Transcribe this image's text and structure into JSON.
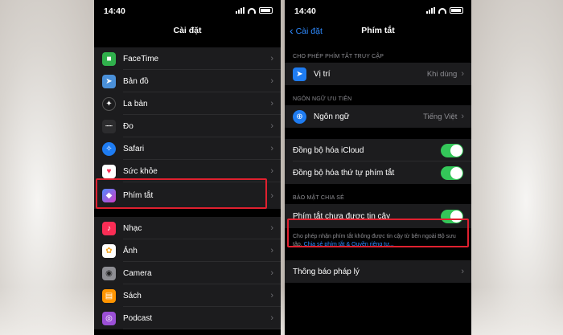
{
  "left": {
    "status_time": "14:40",
    "title": "Cài đặt",
    "group1": [
      {
        "label": "FaceTime",
        "icon": "facetime-icon",
        "color": "#30b04c"
      },
      {
        "label": "Bản đồ",
        "icon": "maps-icon",
        "color": "#4a90d9"
      },
      {
        "label": "La bàn",
        "icon": "compass-icon",
        "color": "#1c1c1e"
      },
      {
        "label": "Đo",
        "icon": "measure-icon",
        "color": "#1c1c1e"
      },
      {
        "label": "Safari",
        "icon": "safari-icon",
        "color": "#1e7cf2"
      },
      {
        "label": "Sức khỏe",
        "icon": "health-icon",
        "color": "#ffffff"
      },
      {
        "label": "Phím tắt",
        "icon": "shortcuts-icon",
        "color": "#5a4fd6"
      }
    ],
    "group2": [
      {
        "label": "Nhạc",
        "icon": "music-icon",
        "color": "#fa2d55"
      },
      {
        "label": "Ảnh",
        "icon": "photos-icon",
        "color": "#ffffff"
      },
      {
        "label": "Camera",
        "icon": "camera-icon",
        "color": "#8e8e93"
      },
      {
        "label": "Sách",
        "icon": "books-icon",
        "color": "#ff9500"
      },
      {
        "label": "Podcast",
        "icon": "podcast-icon",
        "color": "#9b4fd6"
      }
    ]
  },
  "right": {
    "status_time": "14:40",
    "back_label": "Cài đặt",
    "title": "Phím tắt",
    "section_access": "CHO PHÉP PHÍM TẮT TRUY CẬP",
    "location_label": "Vị trí",
    "location_value": "Khi dùng",
    "section_language": "NGÔN NGỮ ƯU TIÊN",
    "language_label": "Ngôn ngữ",
    "language_value": "Tiếng Việt",
    "sync_icloud": "Đồng bộ hóa iCloud",
    "sync_order": "Đồng bộ hóa thứ tự phím tắt",
    "section_security": "BẢO MẬT CHIA SẺ",
    "untrusted": "Phím tắt chưa được tin cậy",
    "footnote": "Cho phép nhận phím tắt không được tin cậy từ bên ngoài Bộ sưu tập.",
    "footnote_link": "Chia sẻ phím tắt & Quyền riêng tư...",
    "legal": "Thông báo pháp lý"
  },
  "colors": {
    "accent": "#2f8bff",
    "toggle_on": "#34c759",
    "highlight": "#e0202f"
  }
}
